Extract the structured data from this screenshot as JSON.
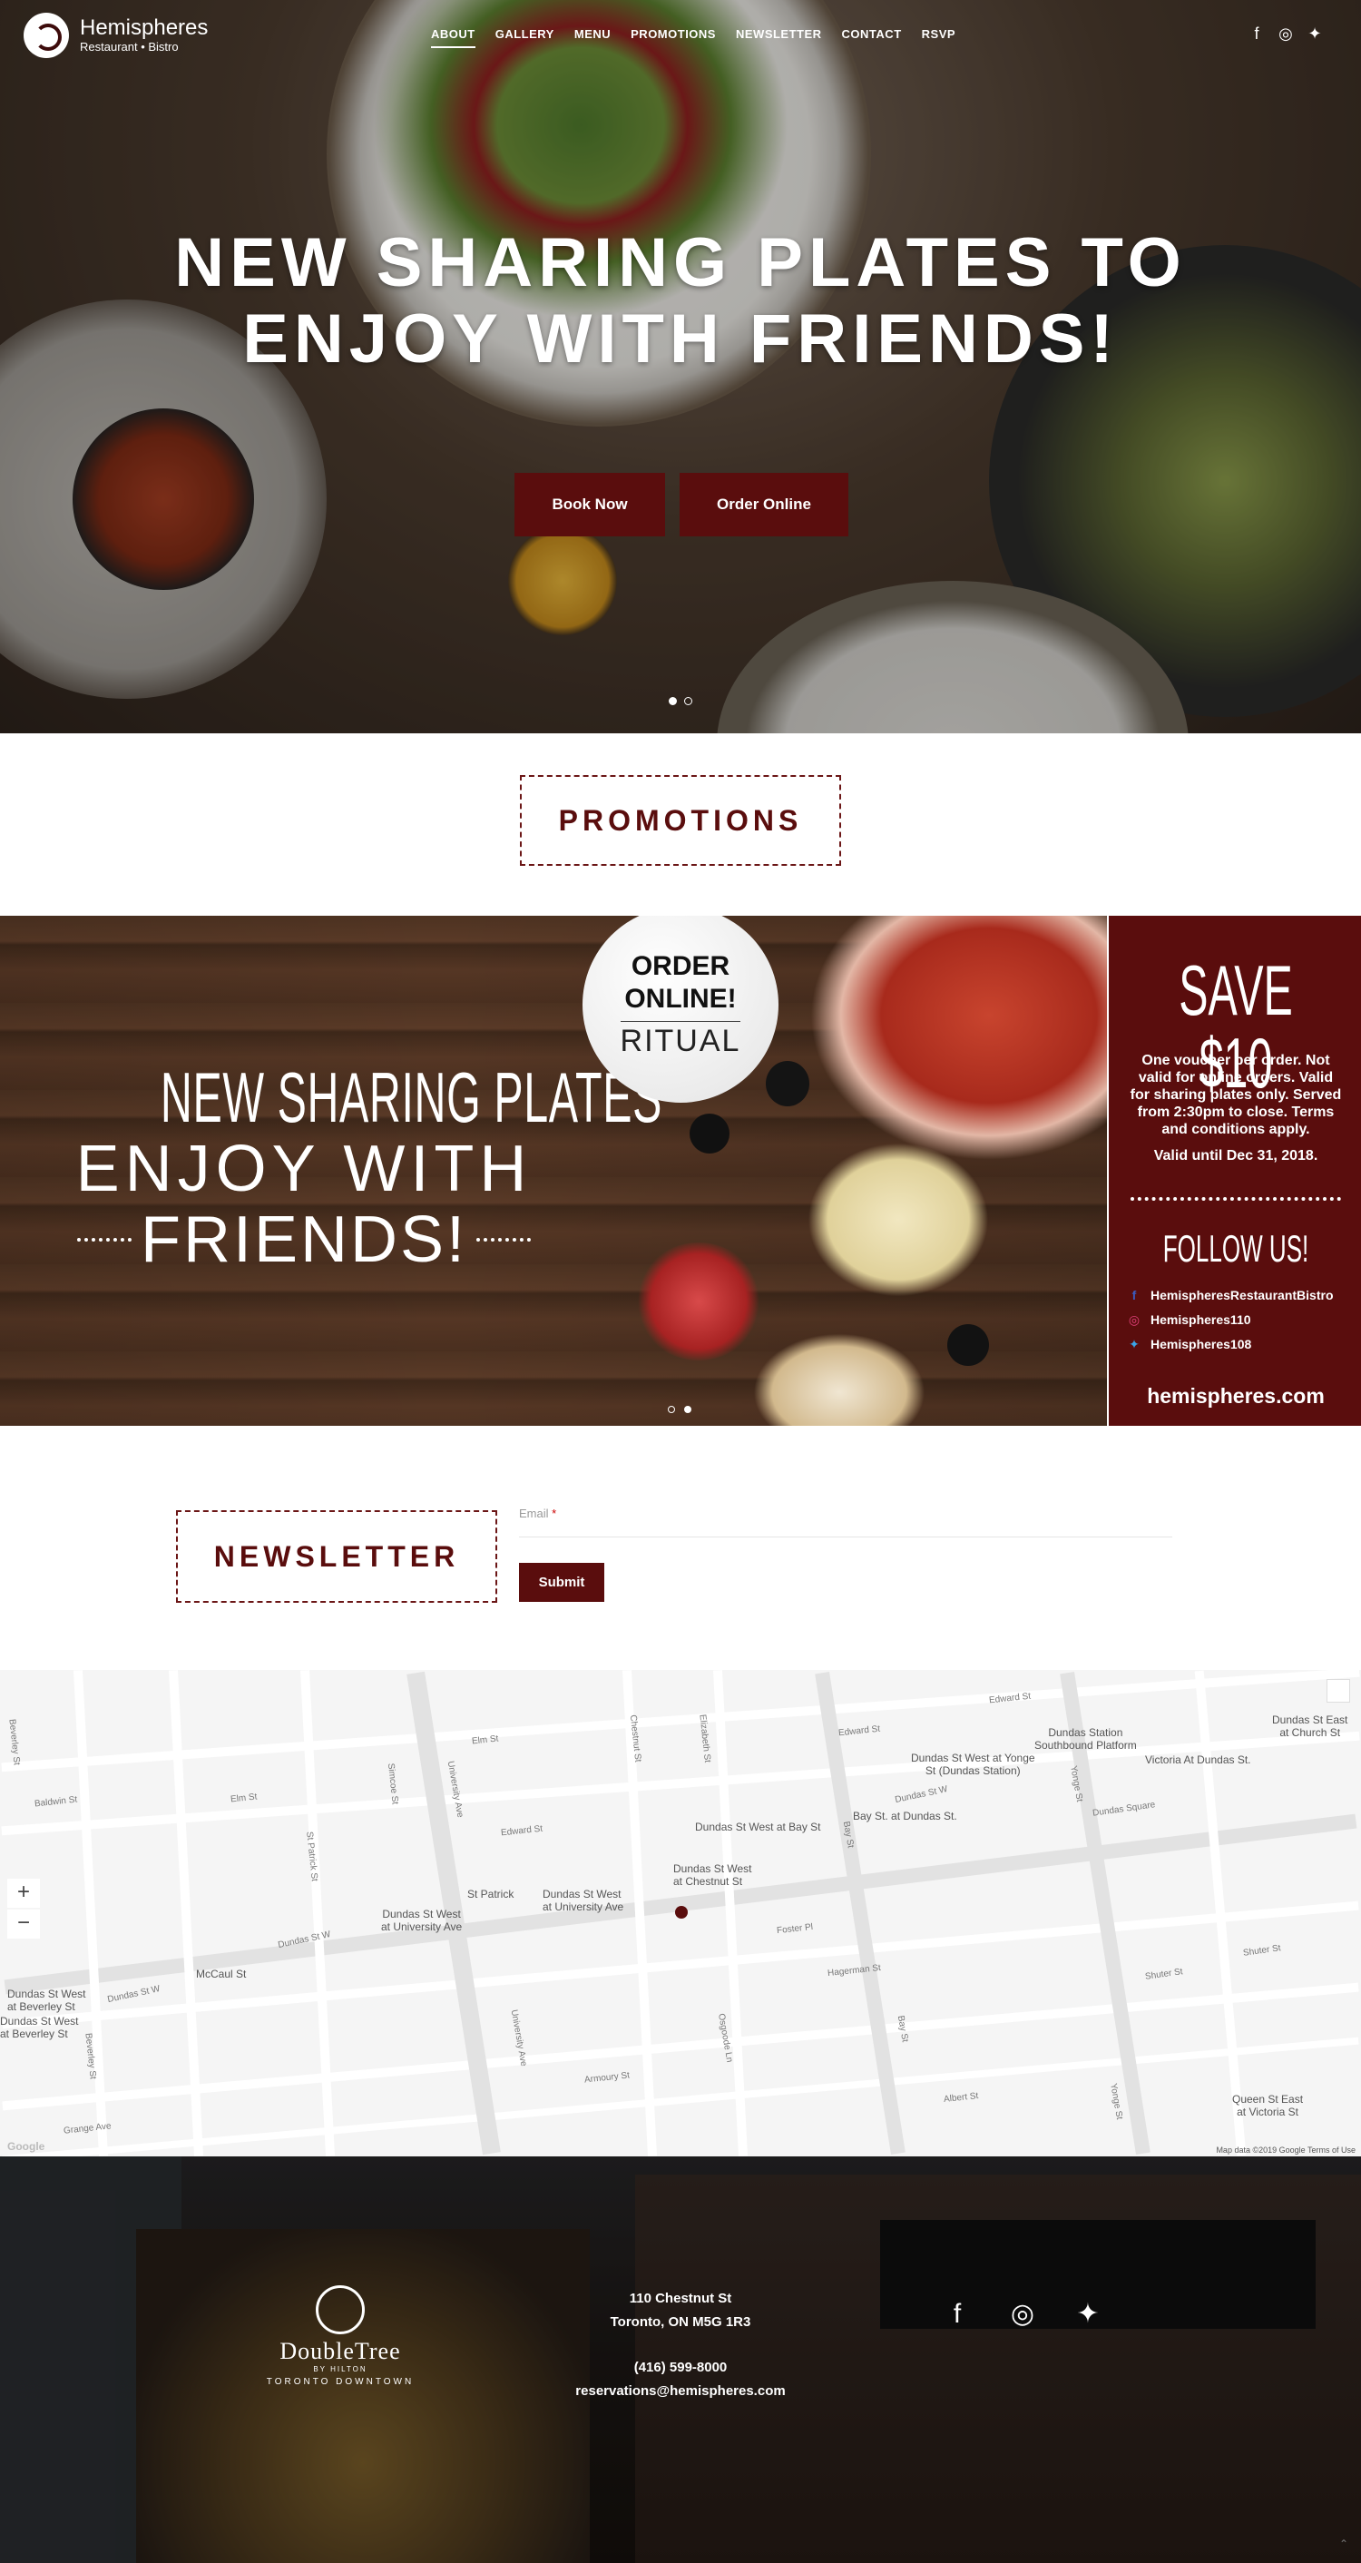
{
  "brand": {
    "name": "Hemispheres",
    "tagline": "Restaurant • Bistro"
  },
  "nav": {
    "items": [
      {
        "label": "ABOUT"
      },
      {
        "label": "GALLERY"
      },
      {
        "label": "MENU"
      },
      {
        "label": "PROMOTIONS"
      },
      {
        "label": "NEWSLETTER"
      },
      {
        "label": "CONTACT"
      },
      {
        "label": "RSVP"
      }
    ],
    "active": "ABOUT",
    "social": [
      "facebook-icon",
      "instagram-icon",
      "twitter-icon"
    ]
  },
  "hero": {
    "title": "NEW SHARING PLATES TO ENJOY WITH FRIENDS!",
    "book_label": "Book Now",
    "order_label": "Order Online",
    "slide_count": 2,
    "active_slide": 1
  },
  "promotions": {
    "heading": "PROMOTIONS",
    "banner": {
      "line1": "NEW SHARING PLATES",
      "line2": "ENJOY WITH",
      "line3": "FRIENDS!",
      "badge_line1": "ORDER",
      "badge_line2": "ONLINE!",
      "badge_brand": "RITUAL",
      "offer": "SAVE $10",
      "terms": "One voucher per order. Not valid for online orders. Valid for sharing plates only. Served from 2:30pm to close. Terms and conditions apply.",
      "valid": "Valid until Dec 31, 2018.",
      "follow": "FOLLOW US!",
      "facebook": "HemispheresRestaurantBistro",
      "instagram": "Hemispheres110",
      "twitter": "Hemispheres108",
      "website": "hemispheres.com",
      "slide_count": 2,
      "active_slide": 2
    }
  },
  "newsletter": {
    "heading": "NEWSLETTER",
    "email_label": "Email",
    "email_value": "",
    "submit_label": "Submit"
  },
  "map": {
    "labels": {
      "dundas_station": "Dundas Station\nSouthbound Platform",
      "dundas_yonge": "Dundas St West at Yonge\nSt (Dundas Station)",
      "victoria_dundas": "Victoria At Dundas St.",
      "dundas_church": "Dundas St East\nat Church St",
      "dundas_bay": "Dundas St West at Bay St",
      "bay_dundas": "Bay St. at Dundas St.",
      "dundas_chestnut": "Dundas St West\nat Chestnut St",
      "st_patrick": "St Patrick",
      "dundas_univ1": "Dundas St West\nat University Ave",
      "dundas_univ2": "Dundas St West\nat University Ave",
      "mccaul": "McCaul St",
      "dundas_beverley1": "Dundas St West\nat Beverley St",
      "dundas_beverley2": "Dundas St West\nat Beverley St",
      "queen_victoria": "Queen St East\nat Victoria St",
      "dundas_w1": "Dundas St W",
      "dundas_w2": "Dundas St W",
      "dundas_w3": "Dundas St W",
      "dundas_sq": "Dundas Square",
      "shuter1": "Shuter St",
      "shuter2": "Shuter St",
      "edward1": "Edward St",
      "edward2": "Edward St",
      "edward3": "Edward St",
      "elm1": "Elm St",
      "elm2": "Elm St",
      "baldwin": "Baldwin St",
      "university": "University Ave",
      "university2": "University Ave",
      "bay": "Bay St",
      "bay2": "Bay St",
      "yonge": "Yonge St",
      "yonge2": "Yonge St",
      "beverley": "Beverley St",
      "beverley2": "Beverley St",
      "armoury": "Armoury St",
      "hagerman": "Hagerman St",
      "albert": "Albert St",
      "orde": "Osgoode Ln",
      "foster": "Foster Pl",
      "grange": "Grange Ave",
      "stpatrick_st": "St Patrick St",
      "simcoe": "Simcoe St",
      "chestnut": "Chestnut St",
      "elizabeth": "Elizabeth St"
    },
    "attribution": "Map data ©2019 Google    Terms of Use",
    "google_label": "Google",
    "zoom_in": "+",
    "zoom_out": "−"
  },
  "footer": {
    "hotel_name": "DoubleTree",
    "hotel_by": "BY HILTON",
    "hotel_sub": "TORONTO DOWNTOWN",
    "address1": "110 Chestnut St",
    "address2": "Toronto, ON M5G 1R3",
    "phone": "(416) 599-8000",
    "email": "reservations@hemispheres.com",
    "social": [
      "facebook-icon",
      "instagram-icon",
      "twitter-icon"
    ]
  },
  "colors": {
    "brand_red": "#5a0d0d"
  }
}
